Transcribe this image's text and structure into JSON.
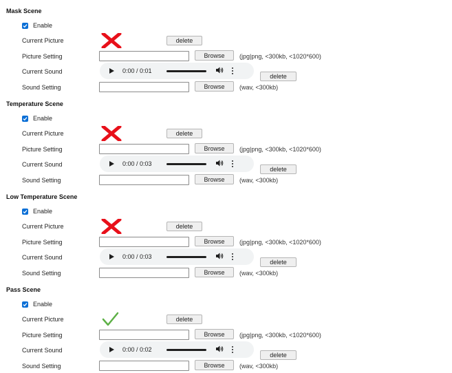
{
  "scenes": [
    {
      "title": "Mask Scene",
      "enable_label": "Enable",
      "picture_state": "x-mark",
      "labels": {
        "current_picture": "Current Picture",
        "picture_setting": "Picture Setting",
        "current_sound": "Current Sound",
        "sound_setting": "Sound Setting"
      },
      "delete_label": "delete",
      "browse_label": "Browse",
      "picture_hint": "(jpg|png, <300kb, <1020*600)",
      "sound_hint": "(wav, <300kb)",
      "audio_time": "0:00 / 0:01"
    },
    {
      "title": "Temperature Scene",
      "enable_label": "Enable",
      "picture_state": "x-mark",
      "labels": {
        "current_picture": "Current Picture",
        "picture_setting": "Picture Setting",
        "current_sound": "Current Sound",
        "sound_setting": "Sound Setting"
      },
      "delete_label": "delete",
      "browse_label": "Browse",
      "picture_hint": "(jpg|png, <300kb, <1020*600)",
      "sound_hint": "(wav, <300kb)",
      "audio_time": "0:00 / 0:03"
    },
    {
      "title": "Low Temperature Scene",
      "enable_label": "Enable",
      "picture_state": "x-mark",
      "labels": {
        "current_picture": "Current Picture",
        "picture_setting": "Picture Setting",
        "current_sound": "Current Sound",
        "sound_setting": "Sound Setting"
      },
      "delete_label": "delete",
      "browse_label": "Browse",
      "picture_hint": "(jpg|png, <300kb, <1020*600)",
      "sound_hint": "(wav, <300kb)",
      "audio_time": "0:00 / 0:03"
    },
    {
      "title": "Pass Scene",
      "enable_label": "Enable",
      "picture_state": "check-mark",
      "labels": {
        "current_picture": "Current Picture",
        "picture_setting": "Picture Setting",
        "current_sound": "Current Sound",
        "sound_setting": "Sound Setting"
      },
      "delete_label": "delete",
      "browse_label": "Browse",
      "picture_hint": "(jpg|png, <300kb, <1020*600)",
      "sound_hint": "(wav, <300kb)",
      "audio_time": "0:00 / 0:02"
    }
  ],
  "colors": {
    "checkbox": "#0b6fd6",
    "x_mark": "#e8101a",
    "check_mark": "#5db046"
  }
}
